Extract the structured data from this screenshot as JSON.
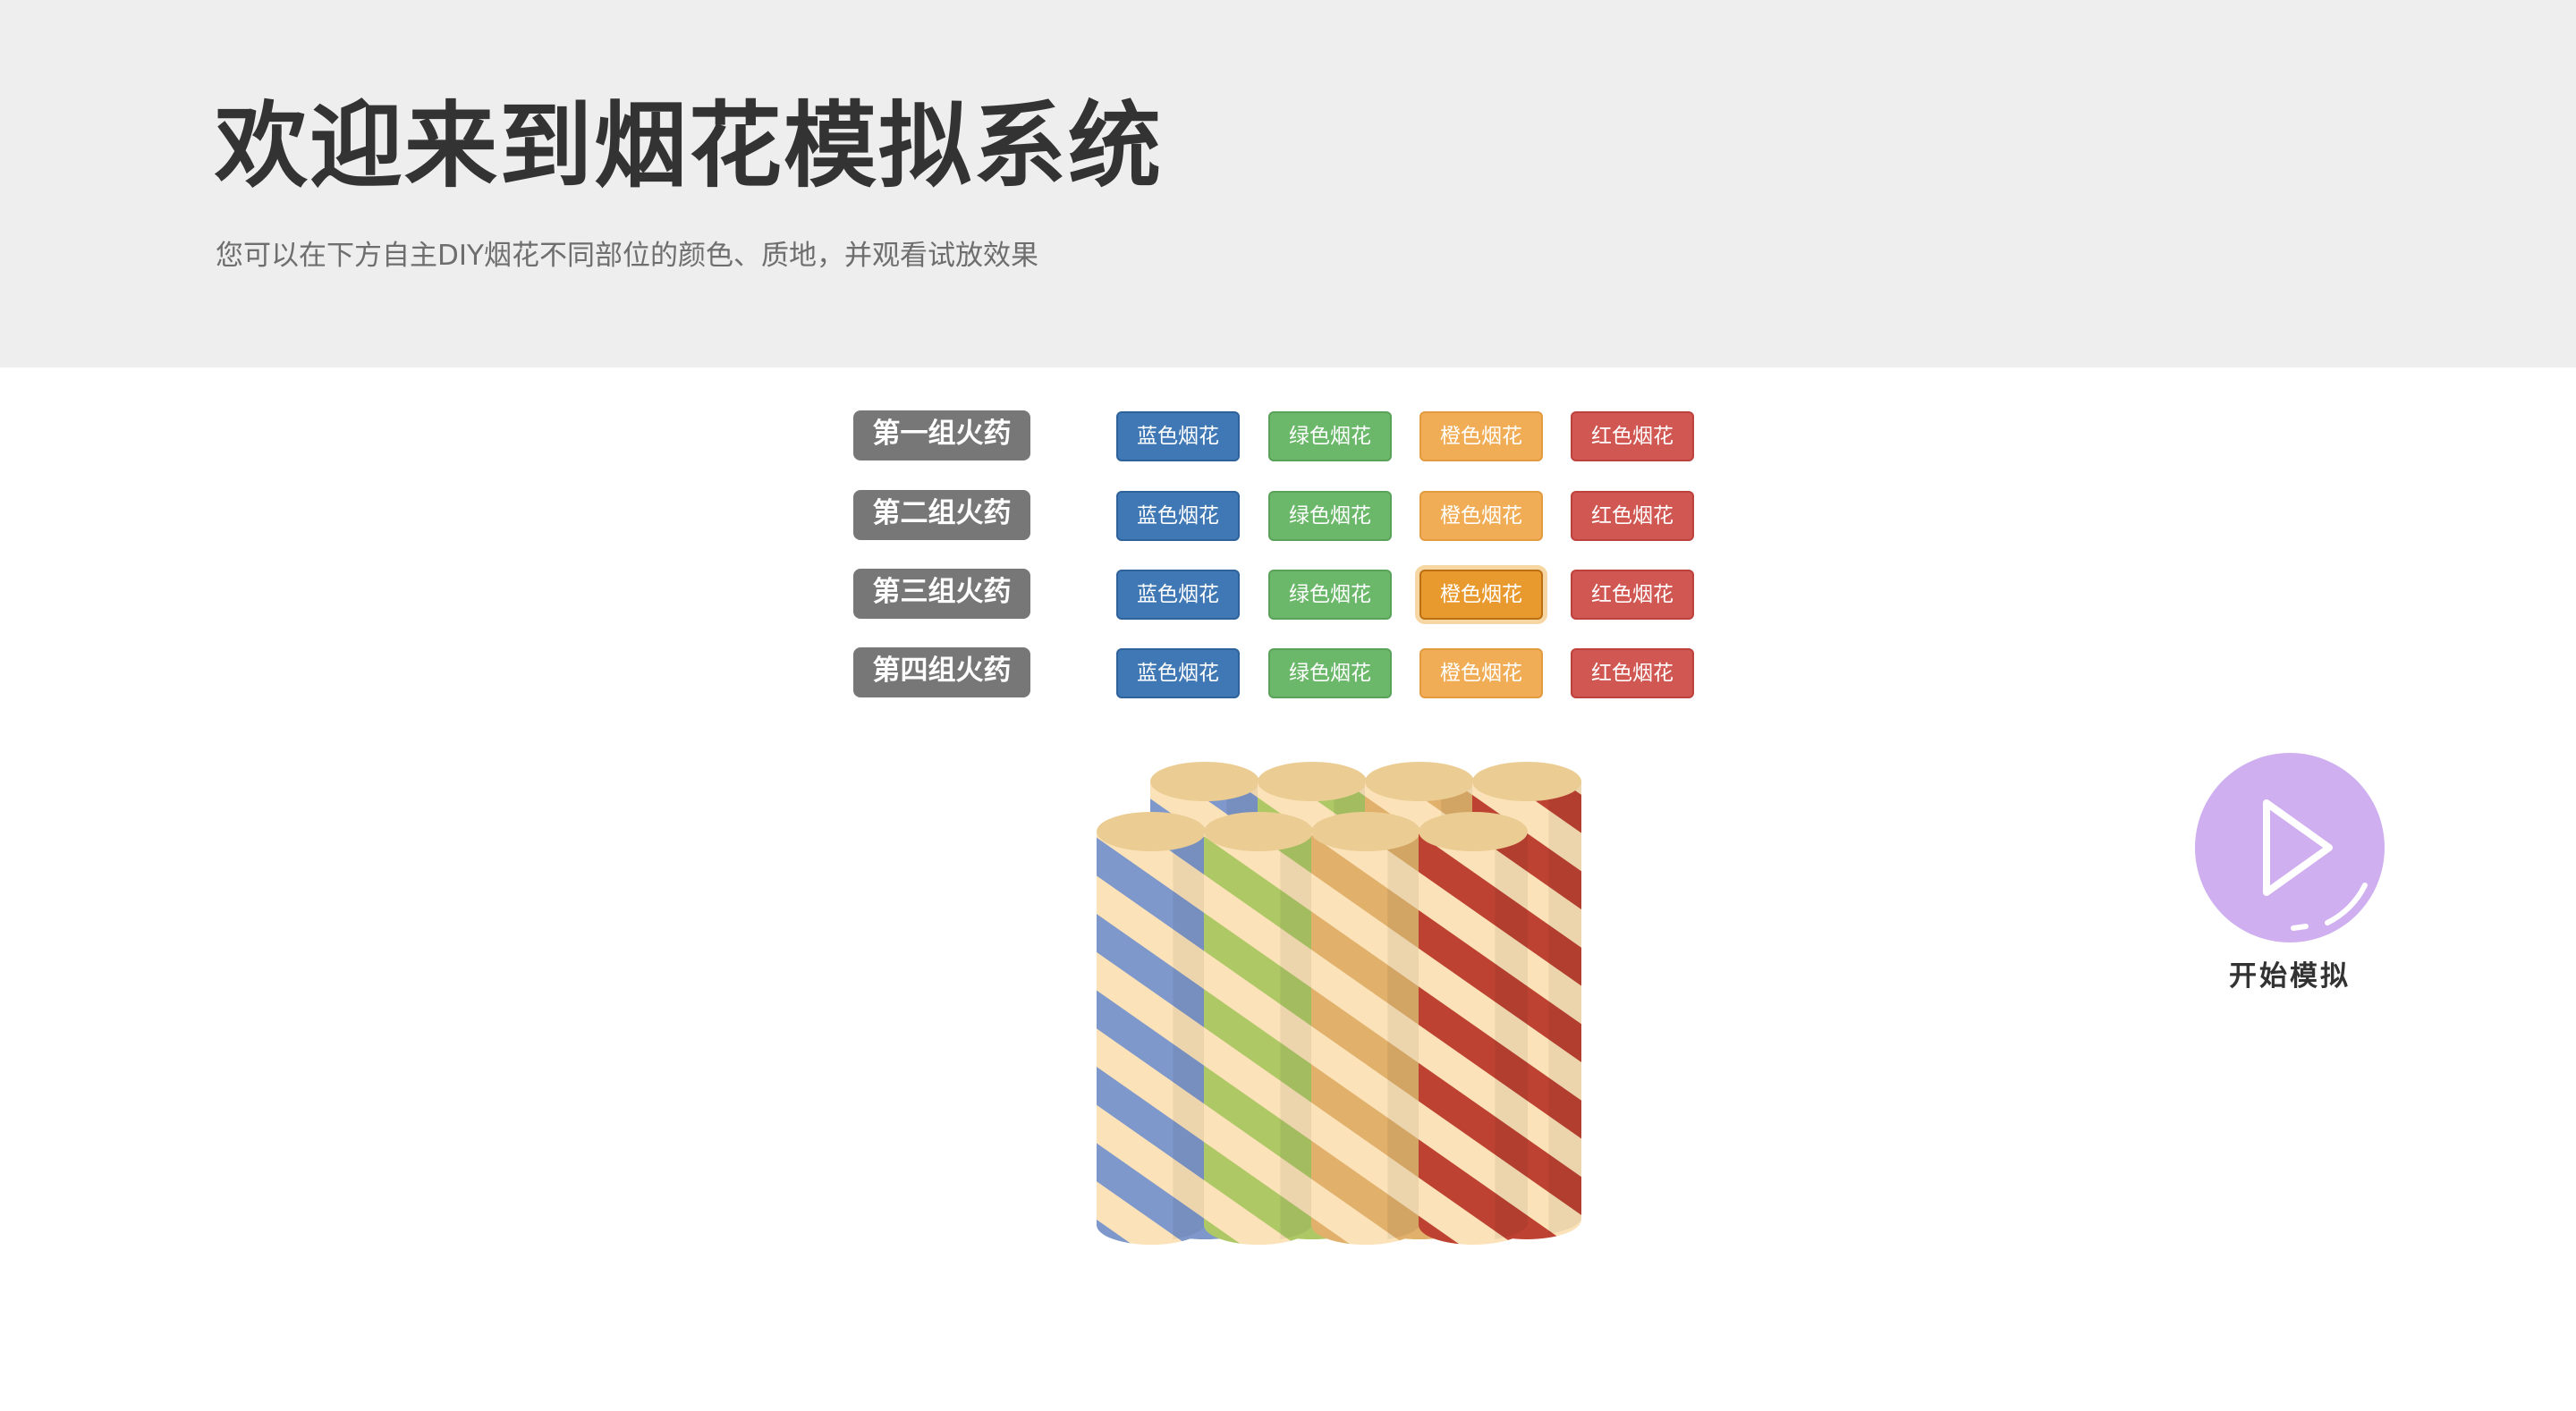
{
  "header": {
    "title": "欢迎来到烟花模拟系统",
    "subtitle": "您可以在下方自主DIY烟花不同部位的颜色、质地，并观看试放效果"
  },
  "groups": [
    {
      "label": "第一组火药",
      "options": [
        "蓝色烟花",
        "绿色烟花",
        "橙色烟花",
        "红色烟花"
      ]
    },
    {
      "label": "第二组火药",
      "options": [
        "蓝色烟花",
        "绿色烟花",
        "橙色烟花",
        "红色烟花"
      ]
    },
    {
      "label": "第三组火药",
      "options": [
        "蓝色烟花",
        "绿色烟花",
        "橙色烟花",
        "红色烟花"
      ],
      "selected": "橙色烟花"
    },
    {
      "label": "第四组火药",
      "options": [
        "蓝色烟花",
        "绿色烟花",
        "橙色烟花",
        "红色烟花"
      ]
    }
  ],
  "colors": {
    "blue": "#7f98cb",
    "green": "#afc866",
    "orange": "#e1b06b",
    "red": "#bd4231",
    "cream": "#fbe2b8",
    "tube_top": "#ebcd93",
    "play_button": "#cfaff0"
  },
  "tubes": {
    "back_row": [
      "blue",
      "green",
      "orange",
      "red"
    ],
    "front_row": [
      "blue",
      "green",
      "orange",
      "red"
    ]
  },
  "simulate": {
    "label": "开始模拟",
    "icon": "play-icon"
  }
}
